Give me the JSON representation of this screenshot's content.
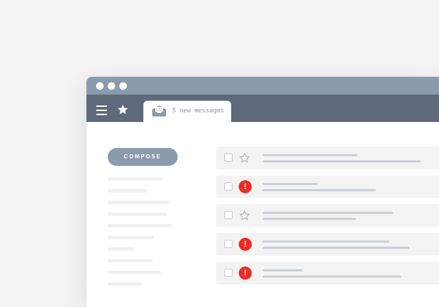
{
  "window": {
    "titlebar_color": "#8a9bad",
    "toolbar_color": "#5e6a7b",
    "window_controls": [
      "dot",
      "dot",
      "dot"
    ]
  },
  "toolbar": {
    "menu_icon": "hamburger-menu-icon",
    "favorites_icon": "star-icon",
    "tab": {
      "icon": "open-envelope-icon",
      "label": "5 new messages"
    }
  },
  "sidebar": {
    "compose_label": "COMPOSE"
  },
  "messages": [
    {
      "flag": "star-outline-icon",
      "important": false
    },
    {
      "flag": "alert-icon",
      "important": true,
      "alert_glyph": "!"
    },
    {
      "flag": "star-outline-icon",
      "important": false
    },
    {
      "flag": "alert-icon",
      "important": true,
      "alert_glyph": "!"
    },
    {
      "flag": "alert-icon",
      "important": true,
      "alert_glyph": "!"
    }
  ],
  "colors": {
    "accent": "#8a9bad",
    "alert": "#ee2a24",
    "row_background": "#f3f3f3",
    "placeholder_line": "#c9ced6"
  }
}
